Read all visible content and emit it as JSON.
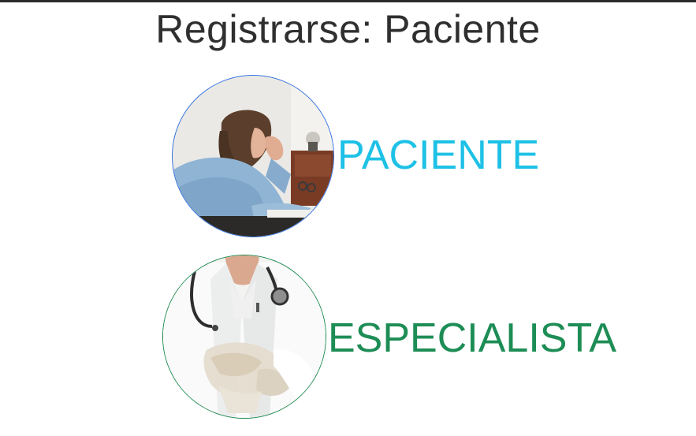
{
  "page": {
    "title": "Registrarse: Paciente"
  },
  "options": [
    {
      "label": "PACIENTE",
      "color": "#1ec1e6",
      "border_color": "#2f6fe0",
      "image": "woman-headache-photo"
    },
    {
      "label": "ESPECIALISTA",
      "color": "#1d8d55",
      "border_color": "#1c8a4f",
      "image": "doctor-gloves-photo"
    }
  ],
  "colors": {
    "top_bar": "#2b2b2b",
    "title": "#2f2f2f"
  }
}
